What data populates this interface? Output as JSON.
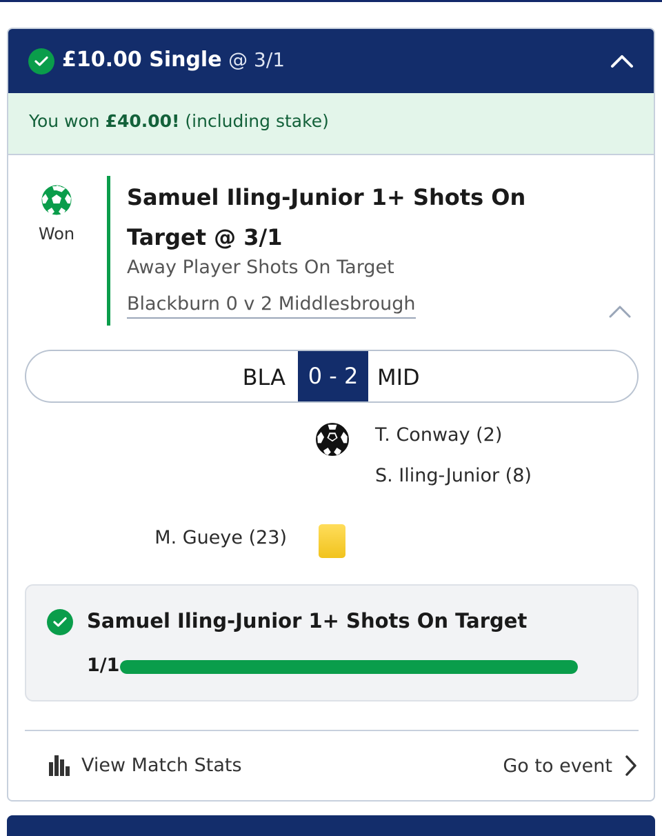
{
  "bet_header": {
    "stake": "£10.00 Single",
    "odds": "@ 3/1"
  },
  "won_banner": {
    "prefix": "You won ",
    "amount": "£40.00!",
    "suffix": " (including stake)"
  },
  "selection": {
    "status": "Won",
    "title": "Samuel Iling-Junior 1+ Shots On Target @ 3/1",
    "market": "Away Player Shots On Target",
    "event": "Blackburn 0 v 2 Middlesbrough"
  },
  "scoreboard": {
    "home": "BLA",
    "score": "0 - 2",
    "away": "MID"
  },
  "match_events": {
    "goals": [
      "T. Conway (2)",
      "S. Iling-Junior (8)"
    ],
    "booking": "M. Gueye (23)"
  },
  "progress": {
    "title": "Samuel Iling-Junior 1+ Shots On Target",
    "count": "1/1",
    "fraction": 1.0
  },
  "footer": {
    "stats_label": "View Match Stats",
    "event_label": "Go to event"
  },
  "colors": {
    "navy": "#132d6b",
    "green": "#0a9d4b",
    "won_bg": "#e3f5ea",
    "yellow_card": "#f1c31d"
  },
  "icons": [
    "check-icon",
    "chevron-up-icon",
    "football-icon",
    "yellow-card-icon",
    "bar-chart-icon",
    "chevron-right-icon"
  ]
}
